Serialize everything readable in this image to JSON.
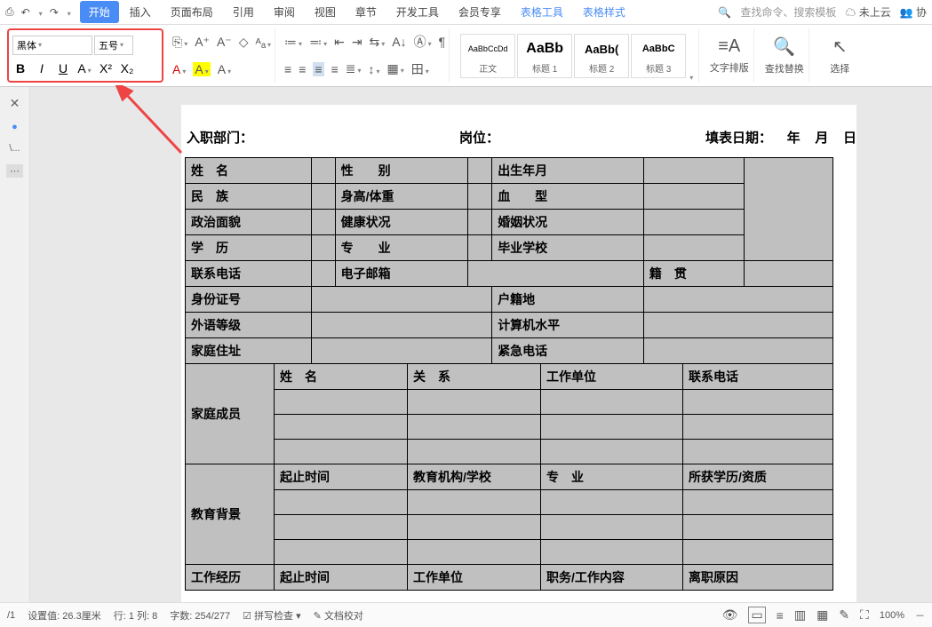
{
  "qat": {
    "save": "⎙",
    "undo": "↶",
    "redo": "↷"
  },
  "menu": {
    "start": "开始",
    "insert": "插入",
    "layout": "页面布局",
    "ref": "引用",
    "review": "审阅",
    "view": "视图",
    "chapter": "章节",
    "dev": "开发工具",
    "member": "会员专享",
    "tabletools": "表格工具",
    "tablestyle": "表格样式"
  },
  "top_right": {
    "search": "查找命令、搜索模板",
    "cloud": "未上云",
    "collab": "协"
  },
  "font": {
    "name": "黑体",
    "size": "五号",
    "bold": "B",
    "italic": "I",
    "underline": "U",
    "strike": "A",
    "super": "X²",
    "sub": "X₂",
    "copyfmt": "⎘",
    "grow": "A⁺",
    "shrink": "A⁻",
    "clear": "◇",
    "case": "ᴬₐ",
    "fontcolor": "A",
    "highlight": "A",
    "charfmt": "A"
  },
  "para": {
    "bullets": "≔",
    "numbers": "≕",
    "outdent": "⇤",
    "indent": "⇥",
    "tabs": "⇆",
    "sort": "A↓",
    "symbol": "Ⓐ",
    "marks": "¶",
    "alignL": "≡",
    "alignC": "≡",
    "alignR": "≡",
    "alignJ": "≡",
    "dist": "≣",
    "linespace": "↕",
    "shading": "▦",
    "borders": "田"
  },
  "styles": {
    "normal_preview": "AaBbCcDd",
    "normal_label": "正文",
    "h1_preview": "AaBb",
    "h1_label": "标题 1",
    "h2_preview": "AaBb(",
    "h2_label": "标题 2",
    "h3_preview": "AaBbC",
    "h3_label": "标题 3"
  },
  "ribbon_end": {
    "layout": "文字排版",
    "find": "查找替换",
    "select": "选择"
  },
  "side": {
    "close": "✕",
    "chat": "●",
    "nav": "\\...",
    "more": "⋯"
  },
  "doc": {
    "dept": "入职部门：",
    "post": "岗位：",
    "date_label": "填表日期：",
    "y": "年",
    "m": "月",
    "d": "日",
    "name": "姓　名",
    "sex": "性　　别",
    "birth": "出生年月",
    "nation": "民　族",
    "hw": "身高/体重",
    "blood": "血　　型",
    "politics": "政治面貌",
    "health": "健康状况",
    "marriage": "婚姻状况",
    "edu": "学　历",
    "major": "专　　业",
    "school": "毕业学校",
    "tel": "联系电话",
    "email": "电子邮箱",
    "origin": "籍　贯",
    "idno": "身份证号",
    "hukou": "户籍地",
    "lang": "外语等级",
    "computer": "计算机水平",
    "addr": "家庭住址",
    "emg": "紧急电话",
    "family": "家庭成员",
    "fname": "姓　名",
    "relation": "关　系",
    "workunit": "工作单位",
    "contacttel": "联系电话",
    "edubg": "教育背景",
    "period": "起止时间",
    "school2": "教育机构/学校",
    "major2": "专　业",
    "degree": "所获学历/资质",
    "workexp": "工作经历",
    "period2": "起止时间",
    "workunit2": "工作单位",
    "duty": "职务/工作内容",
    "leave": "离职原因"
  },
  "status": {
    "page": "/1",
    "setval": "设置值: 26.3厘米",
    "pos": "行: 1  列: 8",
    "words": "字数: 254/277",
    "spell": "拼写检查",
    "proof": "文档校对",
    "zoom": "100%"
  }
}
